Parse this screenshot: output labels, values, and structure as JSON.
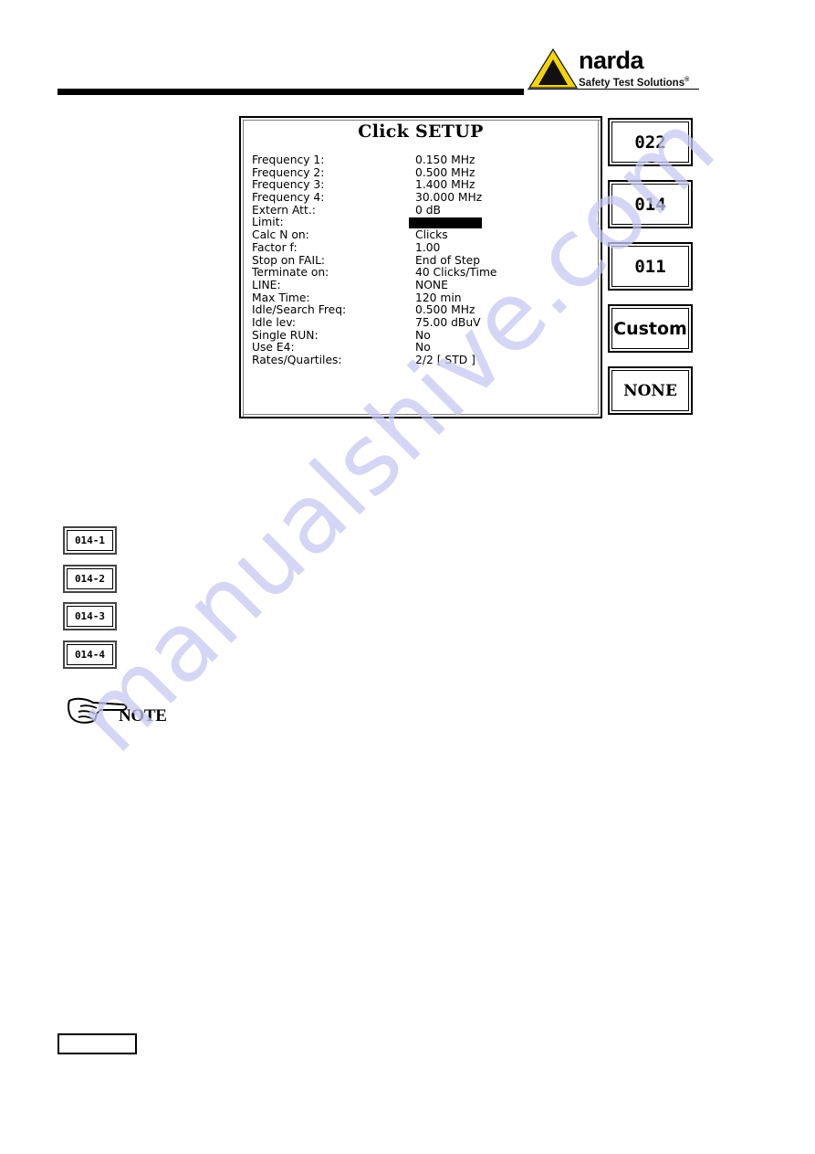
{
  "header": {
    "logo_word": "narda",
    "logo_tagline": "Safety Test Solutions",
    "logo_mark": "®"
  },
  "screen": {
    "title": "Click SETUP",
    "rows": [
      {
        "label": "Frequency 1:",
        "value": "0.150  MHz"
      },
      {
        "label": "Frequency 2:",
        "value": "0.500  MHz"
      },
      {
        "label": "Frequency 3:",
        "value": "1.400  MHz"
      },
      {
        "label": "Frequency 4:",
        "value": "30.000  MHz"
      },
      {
        "label": "Extern Att.:",
        "value": "0  dB"
      },
      {
        "label": "Limit:",
        "value": ""
      },
      {
        "label": "Calc N on:",
        "value": "Clicks"
      },
      {
        "label": "Factor f:",
        "value": "1.00"
      },
      {
        "label": "Stop on FAIL:",
        "value": "End  of  Step"
      },
      {
        "label": "Terminate on:",
        "value": "40  Clicks/Time"
      },
      {
        "label": "LINE:",
        "value": "NONE"
      },
      {
        "label": "Max Time:",
        "value": "120  min"
      },
      {
        "label": "Idle/Search Freq:",
        "value": "0.500  MHz"
      },
      {
        "label": "Idle lev:",
        "value": "75.00  dBuV"
      },
      {
        "label": "Single RUN:",
        "value": "No"
      },
      {
        "label": "Use E4:",
        "value": "No"
      },
      {
        "label": "Rates/Quartiles:",
        "value": "2/2 [ STD ]"
      }
    ]
  },
  "softkeys": [
    "022",
    "014",
    "011",
    "Custom",
    "NONE"
  ],
  "subkeys": [
    "014-1",
    "014-2",
    "014-3",
    "014-4"
  ],
  "note": {
    "label": "NOTE",
    "icon": "pointing-hand-icon"
  },
  "watermark": "manualshive.com"
}
